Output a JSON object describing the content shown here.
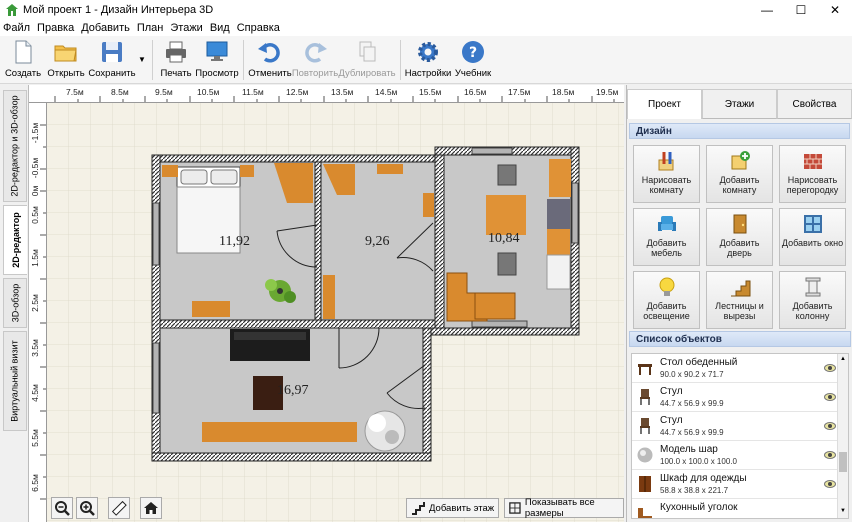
{
  "window": {
    "title": "Мой проект 1 - Дизайн Интерьера 3D",
    "minimize": "—",
    "maximize": "☐",
    "close": "✕"
  },
  "menu": [
    "Файл",
    "Правка",
    "Добавить",
    "План",
    "Этажи",
    "Вид",
    "Справка"
  ],
  "toolbar": {
    "create": "Создать",
    "open": "Открыть",
    "save": "Сохранить",
    "print": "Печать",
    "preview": "Просмотр",
    "undo": "Отменить",
    "redo": "Повторить",
    "duplicate": "Дублировать",
    "settings": "Настройки",
    "tutorial": "Учебник"
  },
  "left_tabs": [
    "2D-редактор и 3D-обзор",
    "2D-редактор",
    "3D-обзор",
    "Виртуальный визит"
  ],
  "ruler": {
    "top": [
      "7.5м",
      "8.5м",
      "9.5м",
      "10.5м",
      "11.5м",
      "12.5м",
      "13.5м",
      "14.5м",
      "15.5м",
      "16.5м",
      "17.5м",
      "18.5м",
      "19.5м"
    ],
    "left": [
      "-1.5м",
      "-0.5м",
      "0м",
      "0.5м",
      "1.5м",
      "2.5м",
      "3.5м",
      "4.5м",
      "5.5м",
      "6.5м"
    ]
  },
  "rooms": {
    "r1": "11,92",
    "r2": "9,26",
    "r3": "10,84",
    "r4": "16,97"
  },
  "bottom": {
    "add_floor": "Добавить этаж",
    "show_dims": "Показывать все размеры"
  },
  "right_tabs": {
    "project": "Проект",
    "floors": "Этажи",
    "properties": "Свойства"
  },
  "design": {
    "header": "Дизайн",
    "buttons": [
      "Нарисовать комнату",
      "Добавить комнату",
      "Нарисовать перегородку",
      "Добавить мебель",
      "Добавить дверь",
      "Добавить окно",
      "Добавить освещение",
      "Лестницы и вырезы",
      "Добавить колонну"
    ]
  },
  "objects": {
    "header": "Список объектов",
    "items": [
      {
        "name": "Стол обеденный",
        "dims": "90.0 x 90.2 x 71.7"
      },
      {
        "name": "Стул",
        "dims": "44.7 x 56.9 x 99.9"
      },
      {
        "name": "Стул",
        "dims": "44.7 x 56.9 x 99.9"
      },
      {
        "name": "Модель шар",
        "dims": "100.0 x 100.0 x 100.0"
      },
      {
        "name": "Шкаф для одежды",
        "dims": "58.8 x 38.8 x 221.7"
      },
      {
        "name": "Кухонный уголок",
        "dims": ""
      }
    ]
  }
}
